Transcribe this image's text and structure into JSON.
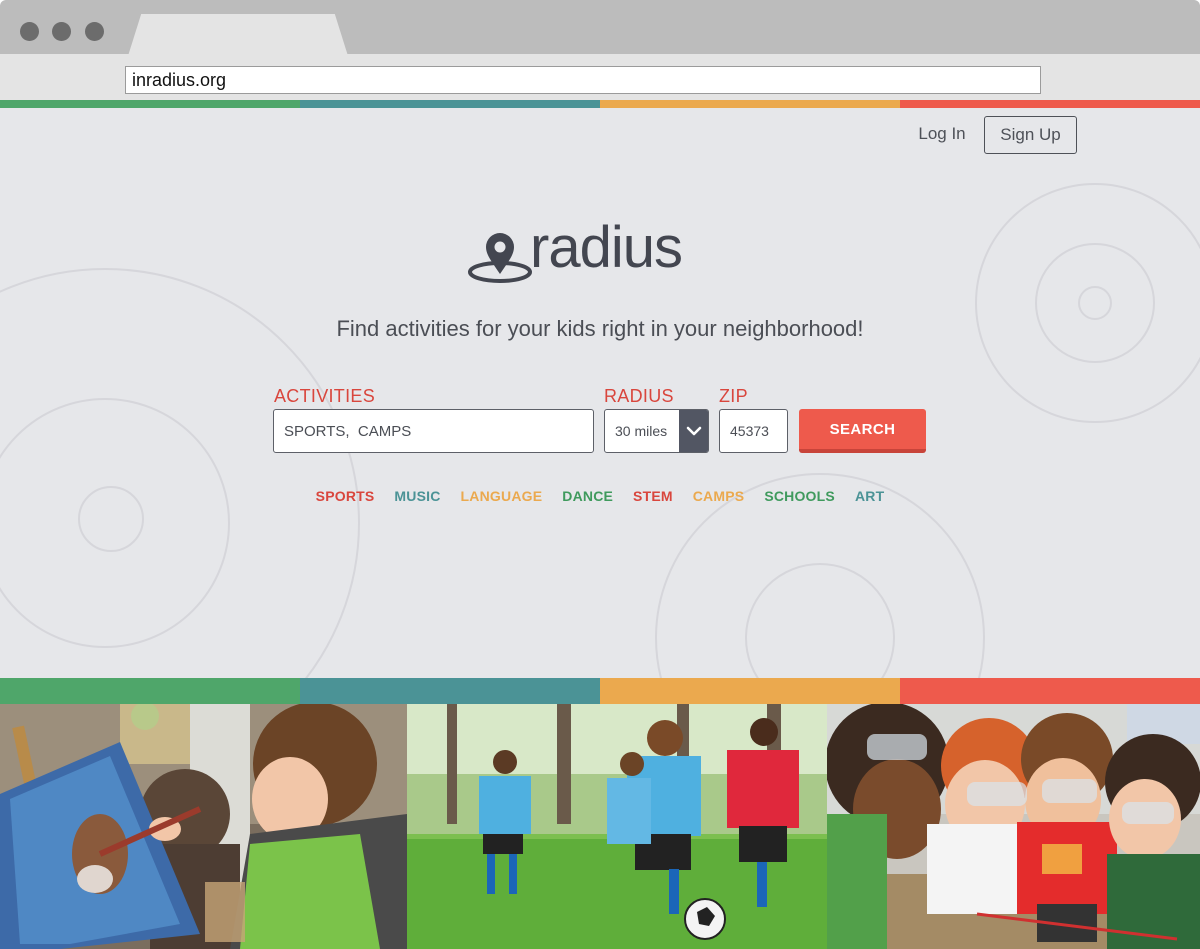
{
  "browser": {
    "url": "inradius.org"
  },
  "colors": {
    "green": "#4fa66a",
    "teal": "#4b9396",
    "orange": "#eba94e",
    "red": "#ee5a4c",
    "dark": "#434650"
  },
  "header": {
    "login_label": "Log In",
    "signup_label": "Sign Up"
  },
  "brand": {
    "name": "radius",
    "logo_icon": "map-pin-icon"
  },
  "hero": {
    "tagline": "Find activities for your kids right in your neighborhood!"
  },
  "search": {
    "activities_label": "ACTIVITIES",
    "activities_value": "SPORTS,  CAMPS",
    "radius_label": "RADIUS",
    "radius_value": "30 miles",
    "zip_label": "ZIP",
    "zip_value": "45373",
    "search_label": "SEARCH"
  },
  "categories": [
    {
      "label": "SPORTS",
      "color": "#d9463d"
    },
    {
      "label": "MUSIC",
      "color": "#4b9396"
    },
    {
      "label": "LANGUAGE",
      "color": "#eba94e"
    },
    {
      "label": "DANCE",
      "color": "#3f9a5d"
    },
    {
      "label": "STEM",
      "color": "#d9463d"
    },
    {
      "label": "CAMPS",
      "color": "#eba94e"
    },
    {
      "label": "SCHOOLS",
      "color": "#3f9a5d"
    },
    {
      "label": "ART",
      "color": "#4b9396"
    }
  ],
  "photos": [
    {
      "name": "child-painting-photo"
    },
    {
      "name": "kids-soccer-photo"
    },
    {
      "name": "kids-science-photo"
    }
  ]
}
